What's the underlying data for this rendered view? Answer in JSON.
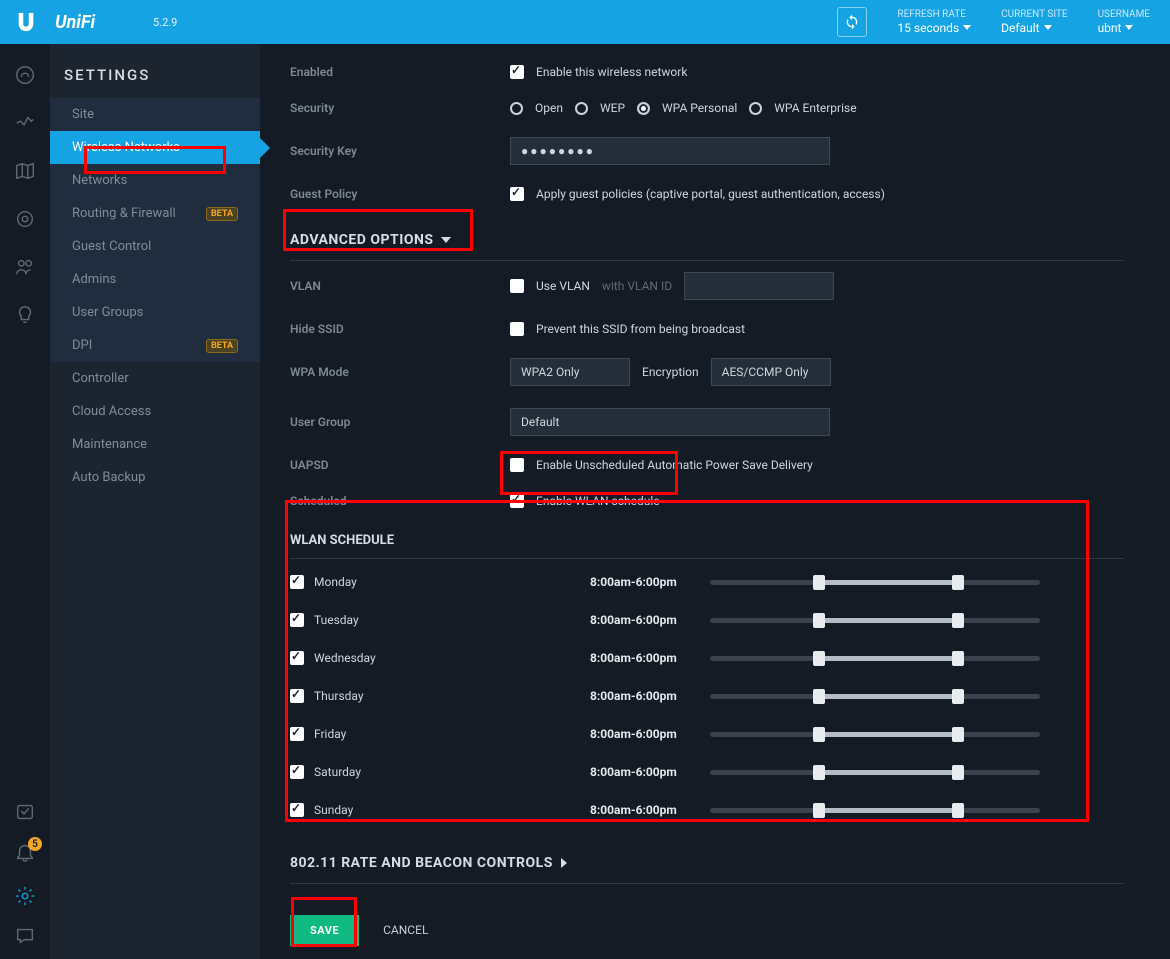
{
  "topbar": {
    "brand_text": "UniFi",
    "version": "5.2.9",
    "refresh_label": "REFRESH RATE",
    "refresh_value": "15 seconds",
    "site_label": "CURRENT SITE",
    "site_value": "Default",
    "user_label": "USERNAME",
    "user_value": "ubnt"
  },
  "settings": {
    "title": "SETTINGS",
    "items": [
      {
        "label": "Site"
      },
      {
        "label": "Wireless Networks",
        "active": true
      },
      {
        "label": "Networks"
      },
      {
        "label": "Routing & Firewall",
        "beta": "BETA"
      },
      {
        "label": "Guest Control"
      },
      {
        "label": "Admins"
      },
      {
        "label": "User Groups"
      },
      {
        "label": "DPI",
        "beta": "BETA"
      },
      {
        "label": "Controller",
        "plain": true
      },
      {
        "label": "Cloud Access",
        "plain": true
      },
      {
        "label": "Maintenance",
        "plain": true
      },
      {
        "label": "Auto Backup",
        "plain": true
      }
    ]
  },
  "form": {
    "enabled_label": "Enabled",
    "enabled_text": "Enable this wireless network",
    "security_label": "Security",
    "sec_open": "Open",
    "sec_wep": "WEP",
    "sec_wpa": "WPA Personal",
    "sec_wpae": "WPA Enterprise",
    "key_label": "Security Key",
    "key_value": "●●●●●●●●",
    "guest_label": "Guest Policy",
    "guest_text": "Apply guest policies (captive portal, guest authentication, access)",
    "adv_header": "ADVANCED OPTIONS",
    "vlan_label": "VLAN",
    "vlan_text": "Use VLAN",
    "vlan_text2": "with VLAN ID",
    "hide_label": "Hide SSID",
    "hide_text": "Prevent this SSID from being broadcast",
    "wpa_label": "WPA Mode",
    "wpa_value": "WPA2 Only",
    "enc_label": "Encryption",
    "enc_value": "AES/CCMP Only",
    "ug_label": "User Group",
    "ug_value": "Default",
    "uapsd_label": "UAPSD",
    "uapsd_text": "Enable Unscheduled Automatic Power Save Delivery",
    "sched_label": "Scheduled",
    "sched_text": "Enable WLAN schedule",
    "wlan_sched_header": "WLAN SCHEDULE",
    "rate_header": "802.11 RATE AND BEACON CONTROLS",
    "save": "SAVE",
    "cancel": "CANCEL"
  },
  "schedule": {
    "monday": {
      "label": "Monday",
      "time": "8:00am-6:00pm",
      "start": 33,
      "end": 75
    },
    "tuesday": {
      "label": "Tuesday",
      "time": "8:00am-6:00pm",
      "start": 33,
      "end": 75
    },
    "wednesday": {
      "label": "Wednesday",
      "time": "8:00am-6:00pm",
      "start": 33,
      "end": 75
    },
    "thursday": {
      "label": "Thursday",
      "time": "8:00am-6:00pm",
      "start": 33,
      "end": 75
    },
    "friday": {
      "label": "Friday",
      "time": "8:00am-6:00pm",
      "start": 33,
      "end": 75
    },
    "saturday": {
      "label": "Saturday",
      "time": "8:00am-6:00pm",
      "start": 33,
      "end": 75
    },
    "sunday": {
      "label": "Sunday",
      "time": "8:00am-6:00pm",
      "start": 33,
      "end": 75
    }
  },
  "bell_count": "5"
}
